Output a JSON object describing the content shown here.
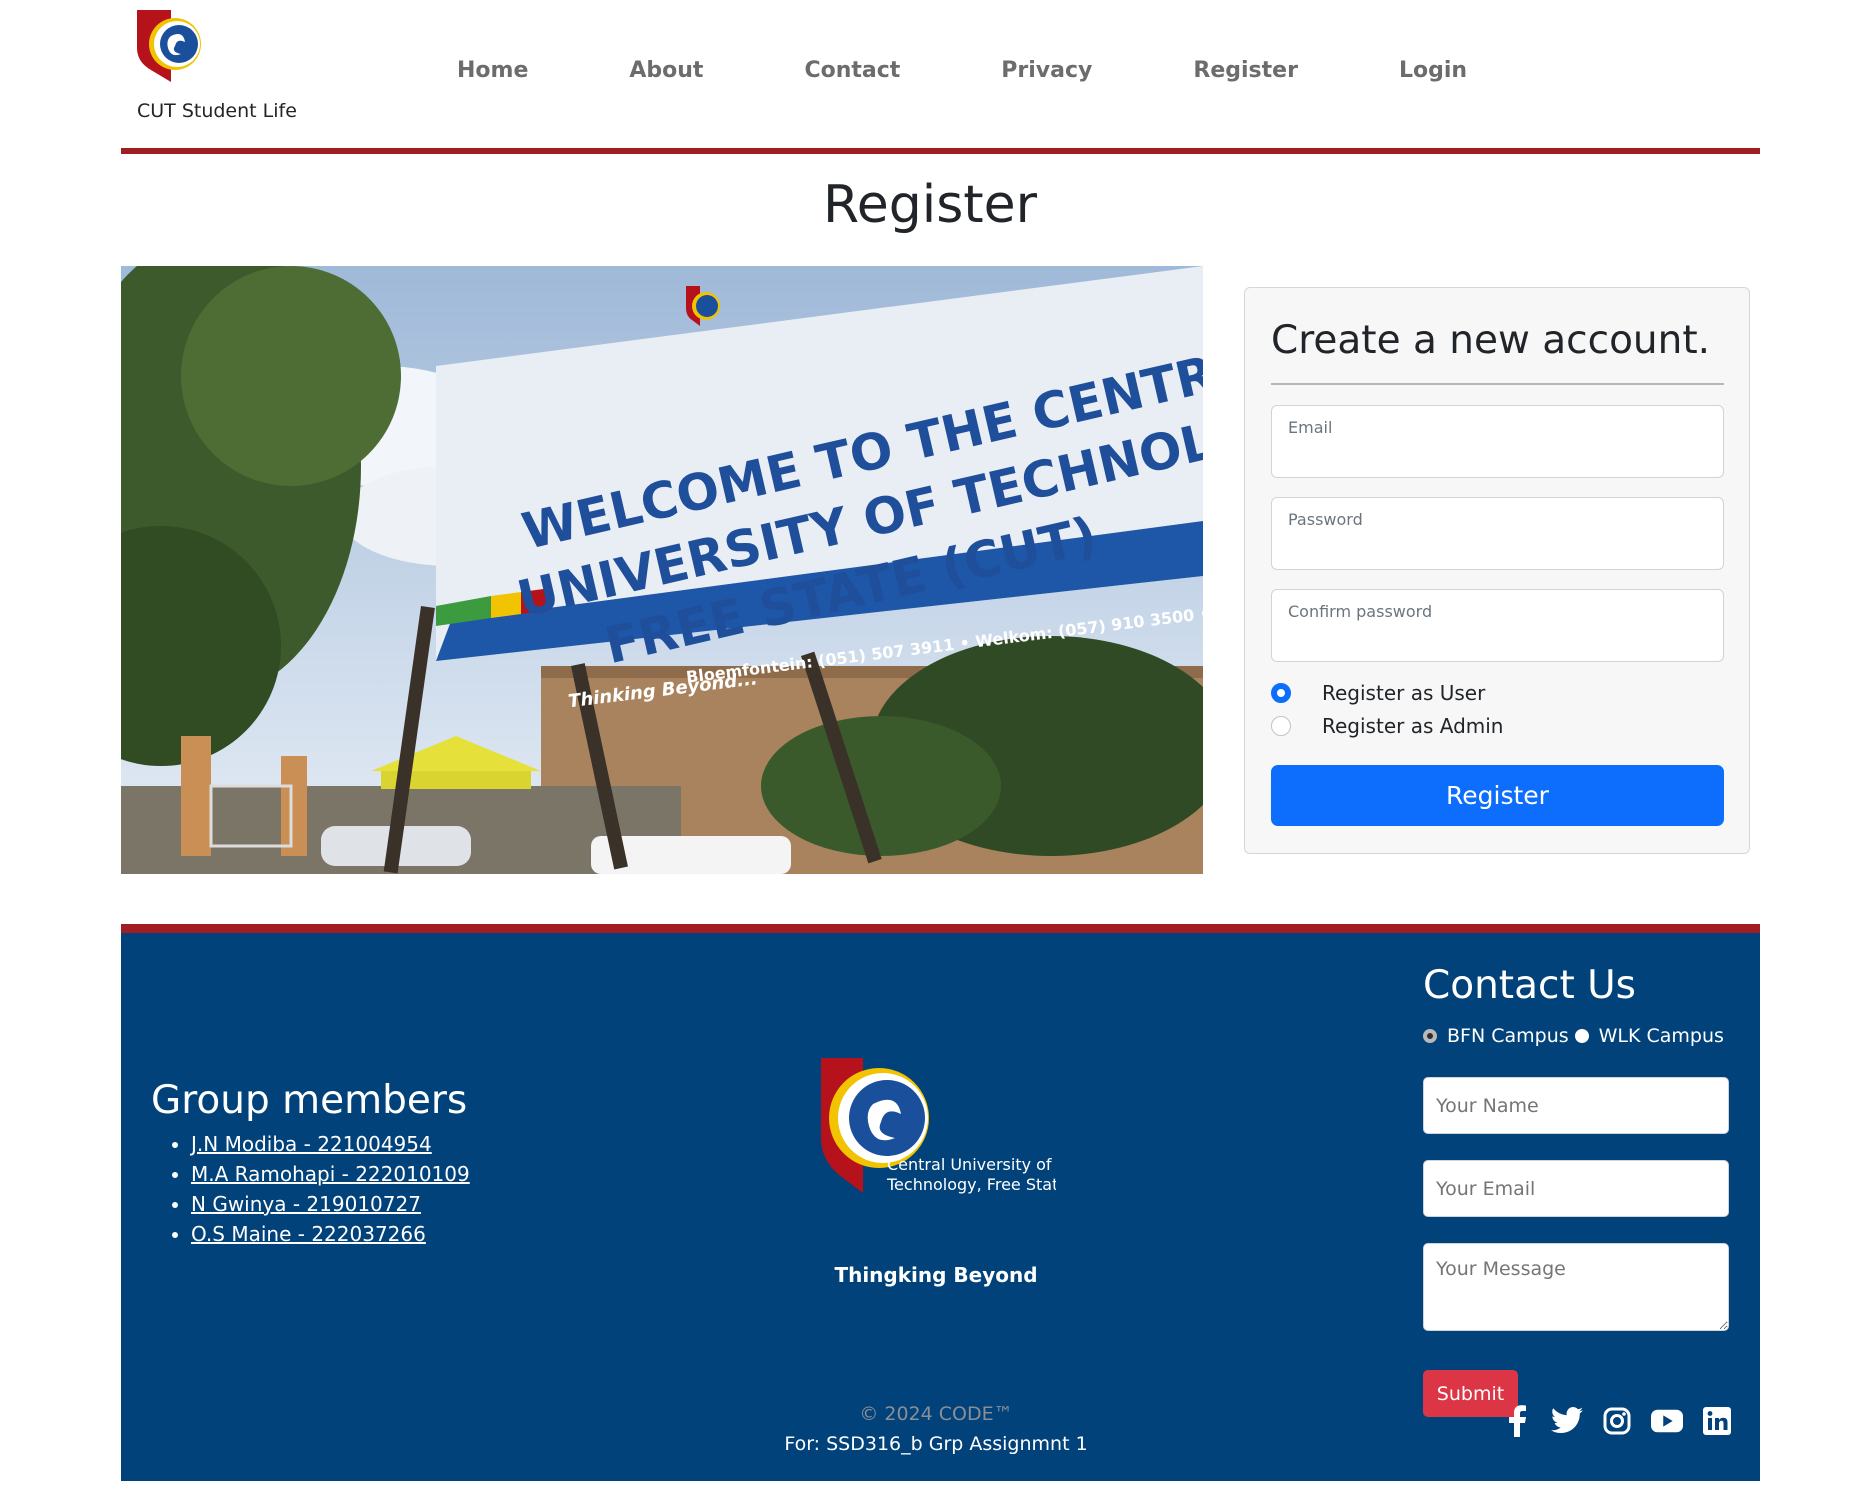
{
  "header": {
    "brand_name": "CUT Student Life",
    "nav": [
      {
        "label": "Home"
      },
      {
        "label": "About"
      },
      {
        "label": "Contact"
      },
      {
        "label": "Privacy"
      },
      {
        "label": "Register"
      },
      {
        "label": "Login"
      }
    ]
  },
  "main": {
    "title": "Register",
    "photo": {
      "sign_headline": "WELCOME TO THE CENTRAL UNIVERSITY OF TECHNOLOGY, FREE STATE (CUT)",
      "sign_contacts": "Bloemfontein: (051) 507 3911 • Welkom: (057) 910 3500 • www.cut.ac.za",
      "sign_slogan": "Thinking Beyond..."
    },
    "form": {
      "heading": "Create a new account.",
      "email_label": "Email",
      "password_label": "Password",
      "confirm_label": "Confirm password",
      "radio_user": "Register as User",
      "radio_admin": "Register as Admin",
      "submit_label": "Register"
    }
  },
  "footer": {
    "members_title": "Group members",
    "members": [
      "J.N Modiba - 221004954",
      "M.A Ramohapi - 222010109",
      "N Gwinya - 219010727",
      "O.S Maine - 222037266"
    ],
    "logo_text_line1": "Central University of",
    "logo_text_line2": "Technology, Free State",
    "tagline": "Thingking Beyond",
    "copyright": "© 2024 CODE™",
    "course": "For: SSD316_b Grp Assignmnt 1",
    "contact": {
      "title": "Contact Us",
      "campus_bfn": "BFN Campus",
      "campus_wlk": "WLK Campus",
      "name_placeholder": "Your Name",
      "email_placeholder": "Your Email",
      "message_placeholder": "Your Message",
      "submit_label": "Submit"
    },
    "socials": [
      "facebook-icon",
      "twitter-icon",
      "instagram-icon",
      "youtube-icon",
      "linkedin-icon"
    ]
  },
  "colors": {
    "accent_red": "#a01d21",
    "footer_blue": "#01427a",
    "primary_blue": "#0d6efd",
    "danger_red": "#dc3545"
  }
}
